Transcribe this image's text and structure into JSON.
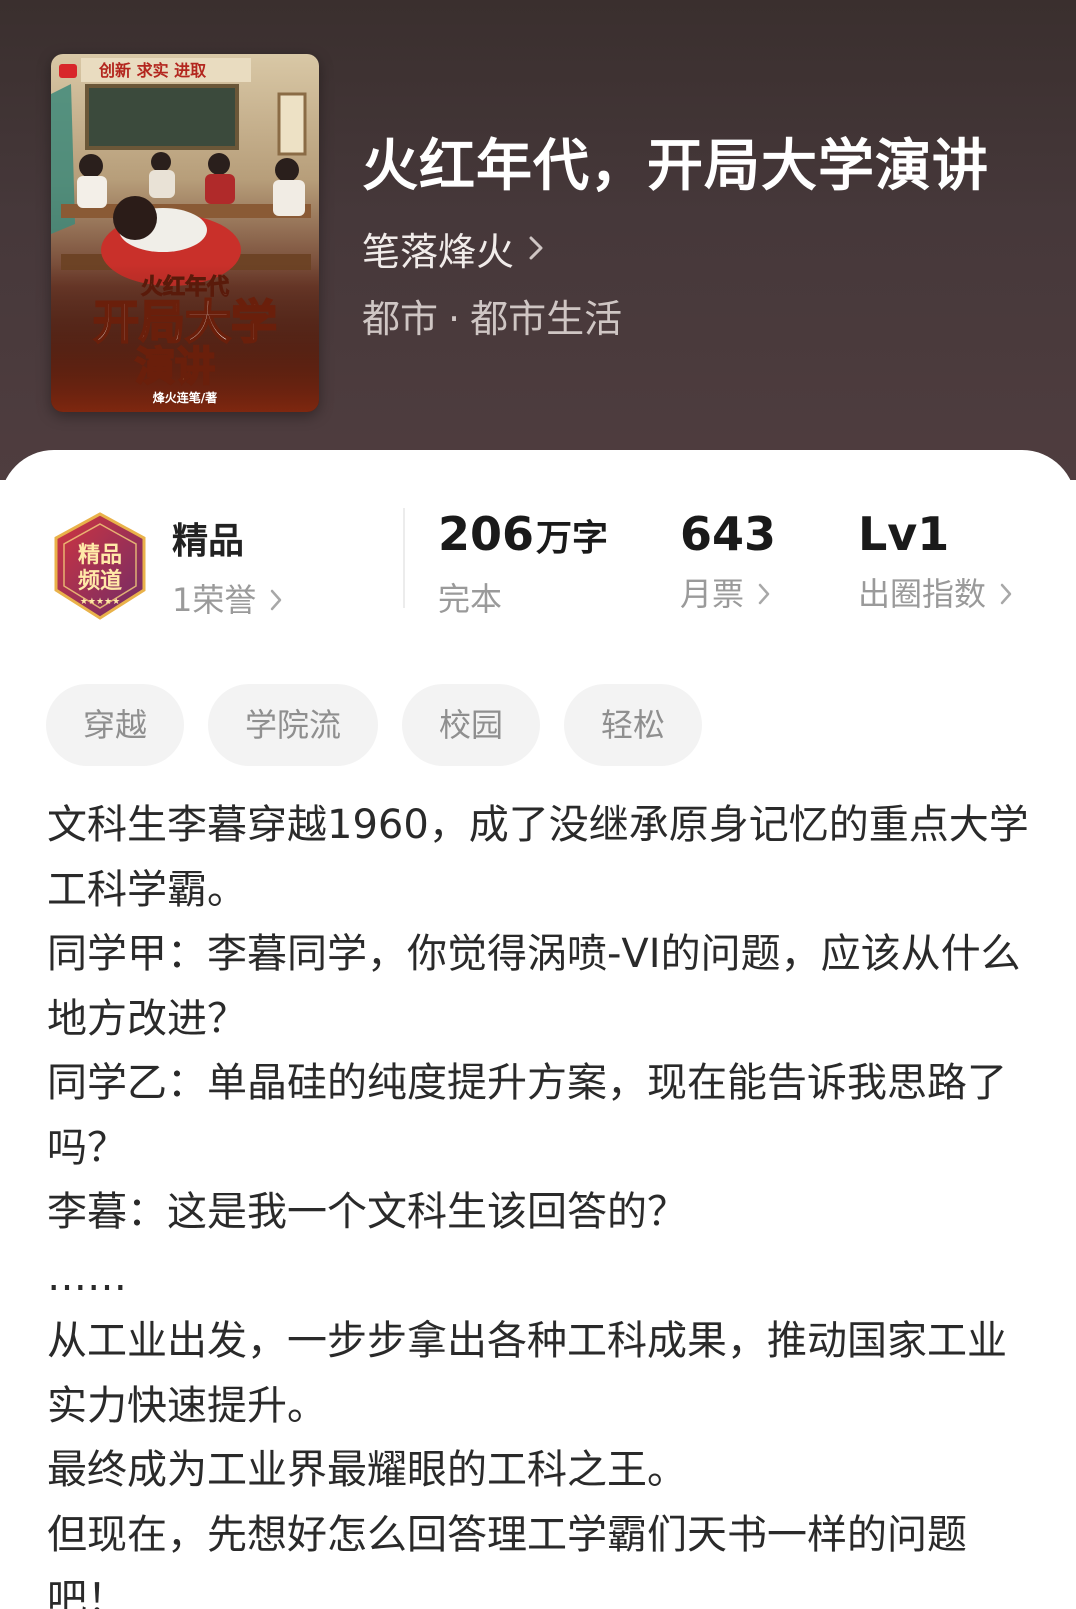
{
  "book": {
    "cover_title_line1": "火红年代",
    "cover_title_line2": "开局大学",
    "cover_title_line3": "演讲",
    "cover_author": "烽火连笔/著",
    "cover_slogan": "创新 求实 进取",
    "title": "火红年代，开局大学演讲",
    "author": "笔落烽火",
    "genre_primary": "都市",
    "genre_separator": "·",
    "genre_secondary": "都市生活"
  },
  "stats": {
    "badge_text_1": "精品",
    "badge_text_2": "频道",
    "honor_title": "精品",
    "honor_sub": "1荣誉",
    "words_value": "206",
    "words_unit": "万字",
    "words_label": "完本",
    "tickets_value": "643",
    "tickets_label": "月票",
    "level_value": "Lv1",
    "level_label": "出圈指数"
  },
  "tags": [
    "穿越",
    "学院流",
    "校园",
    "轻松"
  ],
  "synopsis": [
    "文科生李暮穿越1960，成了没继承原身记忆的重点大学工科学霸。",
    "同学甲：李暮同学，你觉得涡喷-VI的问题，应该从什么地方改进？",
    "同学乙：单晶硅的纯度提升方案，现在能告诉我思路了吗？",
    "李暮：这是我一个文科生该回答的？",
    "……",
    "从工业出发，一步步拿出各种工科成果，推动国家工业实力快速提升。",
    "最终成为工业界最耀眼的工科之王。",
    "但现在，先想好怎么回答理工学霸们天书一样的问题吧！"
  ],
  "colors": {
    "header_bg": "#46383a",
    "text_primary": "#222222",
    "text_secondary": "#9a9a9a",
    "tag_bg": "#f3f3f3",
    "badge_red": "#b0243a",
    "badge_purple": "#6e2c68"
  }
}
